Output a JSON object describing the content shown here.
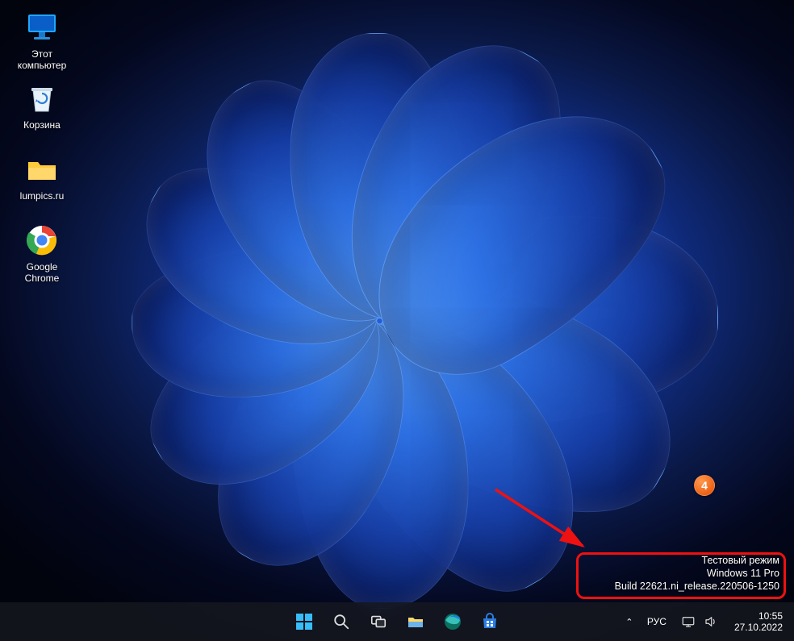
{
  "desktop_icons": [
    {
      "label": "Этот\nкомпьютер"
    },
    {
      "label": "Корзина"
    },
    {
      "label": "lumpics.ru"
    },
    {
      "label": "Google\nChrome"
    }
  ],
  "watermark": {
    "line1": "Тестовый режим",
    "line2": "Windows 11 Pro",
    "line3": "Build 22621.ni_release.220506-1250"
  },
  "annotation": {
    "badge": "4"
  },
  "taskbar": {
    "language": "РУС",
    "time": "10:55",
    "date": "27.10.2022"
  }
}
